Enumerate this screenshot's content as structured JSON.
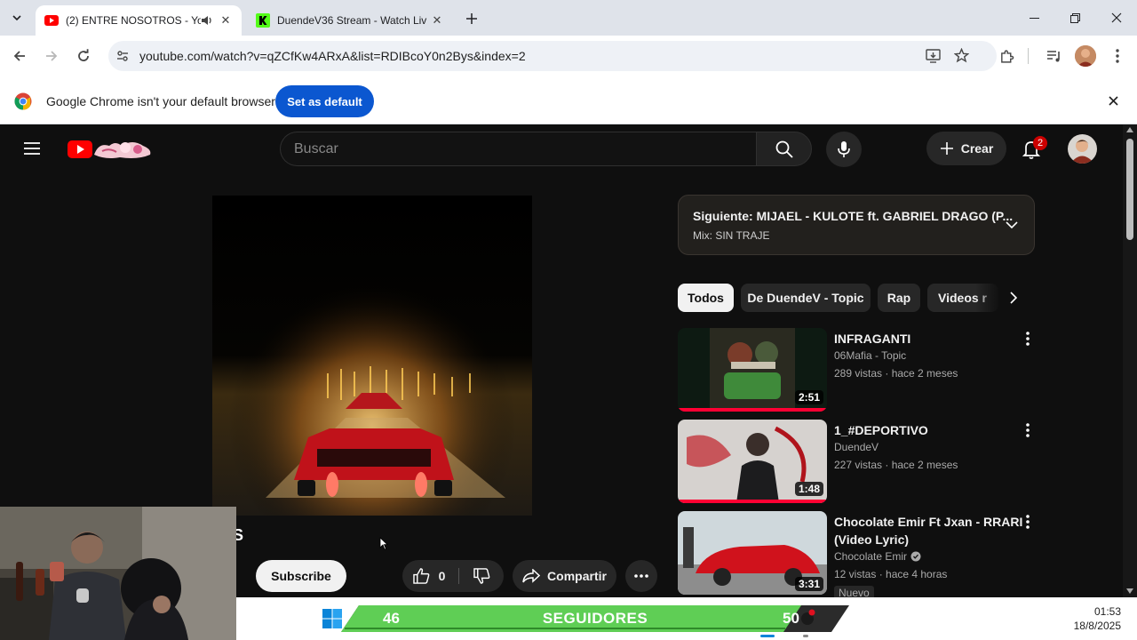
{
  "browser": {
    "tabs": [
      {
        "title": "(2) ENTRE NOSOTROS - You",
        "active": true
      },
      {
        "title": "DuendeV36 Stream - Watch Liv",
        "active": false
      }
    ],
    "url": "youtube.com/watch?v=qZCfKw4ARxA&list=RDIBcoY0n2Bys&index=2",
    "infobar": {
      "text": "Google Chrome isn't your default browser",
      "button": "Set as default"
    }
  },
  "youtube": {
    "search_placeholder": "Buscar",
    "create_label": "Crear",
    "notification_count": "2",
    "next": {
      "title": "Siguiente: MIJAEL - KULOTE ft. GABRIEL DRAGO (P...",
      "subtitle": "Mix: SIN TRAJE"
    },
    "chips": [
      "Todos",
      "De DuendeV - Topic",
      "Rap",
      "Videos r"
    ],
    "recommendations": [
      {
        "title": "INFRAGANTI",
        "channel": "06Mafia - Topic",
        "meta": "289 vistas · hace 2 meses",
        "duration": "2:51"
      },
      {
        "title": "1_#DEPORTIVO",
        "channel": "DuendeV",
        "meta": "227 vistas · hace 2 meses",
        "duration": "1:48"
      },
      {
        "title": "Chocolate Emir Ft Jxan - RRARI (Video Lyric)",
        "channel": "Chocolate Emir",
        "meta": "12 vistas · hace 4 horas",
        "duration": "3:31",
        "badge": "Nuevo"
      }
    ],
    "actions": {
      "subscribe": "Subscribe",
      "likes": "0",
      "share": "Compartir"
    }
  },
  "overlay": {
    "followers_current": "46",
    "followers_label": "SEGUIDORES",
    "followers_goal": "50",
    "channel_glyph": "S"
  },
  "system": {
    "time": "01:53",
    "date": "18/8/2025"
  },
  "colors": {
    "yt_red": "#ff0033",
    "chrome_blue": "#0b57d0",
    "overlay_green": "#5fce55"
  }
}
